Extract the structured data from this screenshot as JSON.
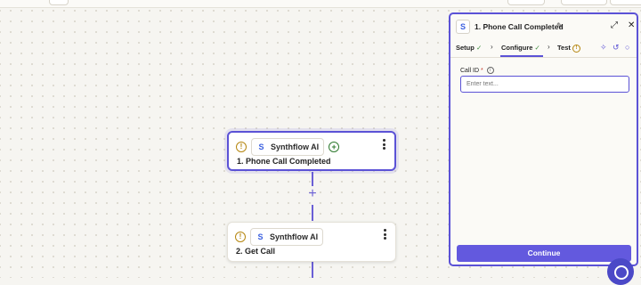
{
  "canvas": {
    "steps": [
      {
        "app_name": "Synthflow AI",
        "app_logo": "S",
        "title": "1. Phone Call Completed",
        "status_icon": "warning-icon",
        "selected": true
      },
      {
        "app_name": "Synthflow AI",
        "app_logo": "S",
        "title": "2. Get Call",
        "status_icon": "warning-icon",
        "selected": false
      }
    ],
    "add_step_symbol": "+"
  },
  "panel": {
    "logo": "S",
    "title": "1. Phone Call Completed",
    "tabs": [
      {
        "label": "Setup",
        "state": "complete"
      },
      {
        "label": "Configure",
        "state": "complete",
        "active": true
      },
      {
        "label": "Test",
        "state": "warning"
      }
    ],
    "field": {
      "label": "Call ID",
      "required_mark": "*",
      "placeholder": "Enter text..."
    },
    "continue_label": "Continue"
  },
  "colors": {
    "accent": "#5b52d6",
    "button": "#6359de",
    "warning": "#b5860f",
    "success": "#3a8a3a"
  }
}
